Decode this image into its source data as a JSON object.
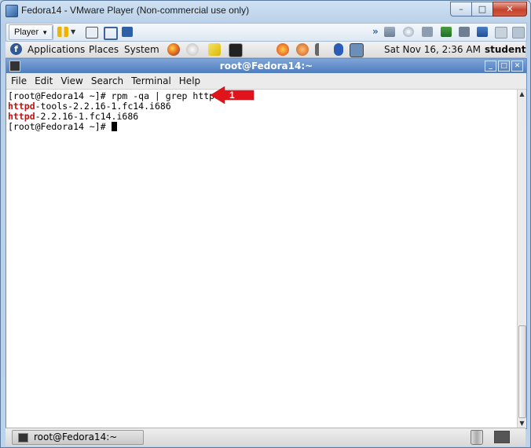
{
  "window": {
    "title": "Fedora14 - VMware Player (Non-commercial use only)",
    "minimize_glyph": "–",
    "maximize_glyph": "□",
    "close_glyph": "✕"
  },
  "vm_toolbar": {
    "player_label": "Player",
    "player_caret": "▼"
  },
  "gnome_panel": {
    "logo_glyph": "f",
    "menus": [
      "Applications",
      "Places",
      "System"
    ],
    "datetime": "Sat Nov 16,  2:36 AM",
    "user": "student"
  },
  "terminal": {
    "title": "root@Fedora14:~",
    "menu": [
      "File",
      "Edit",
      "View",
      "Search",
      "Terminal",
      "Help"
    ],
    "lines": [
      {
        "prefix": "",
        "highlight": "",
        "suffix": "[root@Fedora14 ~]# rpm -qa | grep httpd"
      },
      {
        "prefix": "",
        "highlight": "httpd",
        "suffix": "-tools-2.2.16-1.fc14.i686"
      },
      {
        "prefix": "",
        "highlight": "httpd",
        "suffix": "-2.2.16-1.fc14.i686"
      },
      {
        "prefix": "",
        "highlight": "",
        "suffix": "[root@Fedora14 ~]# "
      }
    ],
    "scroll_up": "▲",
    "scroll_down": "▼"
  },
  "annotation": {
    "label": "1",
    "color": "#e0141a"
  },
  "taskbar": {
    "task_label": "root@Fedora14:~"
  }
}
